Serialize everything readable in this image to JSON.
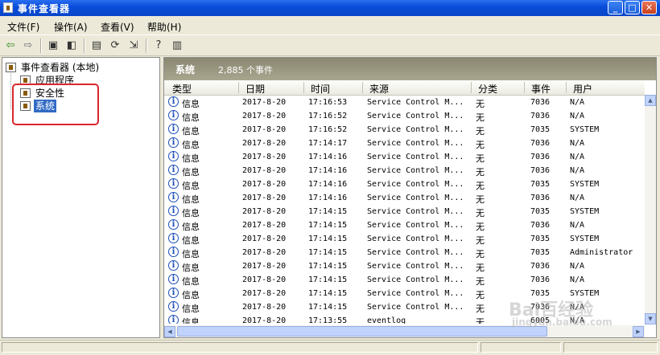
{
  "window": {
    "title": "事件查看器"
  },
  "menu": [
    "文件(F)",
    "操作(A)",
    "查看(V)",
    "帮助(H)"
  ],
  "tree": {
    "root": "事件查看器 (本地)",
    "items": [
      {
        "label": "应用程序",
        "selected": false
      },
      {
        "label": "安全性",
        "selected": false
      },
      {
        "label": "系统",
        "selected": true
      }
    ]
  },
  "list": {
    "name": "系统",
    "count": "2,885 个事件",
    "columns": [
      "类型",
      "日期",
      "时间",
      "来源",
      "分类",
      "事件",
      "用户"
    ],
    "rows": [
      {
        "type": "信息",
        "date": "2017-8-20",
        "time": "17:16:53",
        "source": "Service Control M...",
        "category": "无",
        "event": "7036",
        "user": "N/A"
      },
      {
        "type": "信息",
        "date": "2017-8-20",
        "time": "17:16:52",
        "source": "Service Control M...",
        "category": "无",
        "event": "7036",
        "user": "N/A"
      },
      {
        "type": "信息",
        "date": "2017-8-20",
        "time": "17:16:52",
        "source": "Service Control M...",
        "category": "无",
        "event": "7035",
        "user": "SYSTEM"
      },
      {
        "type": "信息",
        "date": "2017-8-20",
        "time": "17:14:17",
        "source": "Service Control M...",
        "category": "无",
        "event": "7036",
        "user": "N/A"
      },
      {
        "type": "信息",
        "date": "2017-8-20",
        "time": "17:14:16",
        "source": "Service Control M...",
        "category": "无",
        "event": "7036",
        "user": "N/A"
      },
      {
        "type": "信息",
        "date": "2017-8-20",
        "time": "17:14:16",
        "source": "Service Control M...",
        "category": "无",
        "event": "7036",
        "user": "N/A"
      },
      {
        "type": "信息",
        "date": "2017-8-20",
        "time": "17:14:16",
        "source": "Service Control M...",
        "category": "无",
        "event": "7035",
        "user": "SYSTEM"
      },
      {
        "type": "信息",
        "date": "2017-8-20",
        "time": "17:14:16",
        "source": "Service Control M...",
        "category": "无",
        "event": "7036",
        "user": "N/A"
      },
      {
        "type": "信息",
        "date": "2017-8-20",
        "time": "17:14:15",
        "source": "Service Control M...",
        "category": "无",
        "event": "7035",
        "user": "SYSTEM"
      },
      {
        "type": "信息",
        "date": "2017-8-20",
        "time": "17:14:15",
        "source": "Service Control M...",
        "category": "无",
        "event": "7036",
        "user": "N/A"
      },
      {
        "type": "信息",
        "date": "2017-8-20",
        "time": "17:14:15",
        "source": "Service Control M...",
        "category": "无",
        "event": "7035",
        "user": "SYSTEM"
      },
      {
        "type": "信息",
        "date": "2017-8-20",
        "time": "17:14:15",
        "source": "Service Control M...",
        "category": "无",
        "event": "7035",
        "user": "Administrator"
      },
      {
        "type": "信息",
        "date": "2017-8-20",
        "time": "17:14:15",
        "source": "Service Control M...",
        "category": "无",
        "event": "7036",
        "user": "N/A"
      },
      {
        "type": "信息",
        "date": "2017-8-20",
        "time": "17:14:15",
        "source": "Service Control M...",
        "category": "无",
        "event": "7036",
        "user": "N/A"
      },
      {
        "type": "信息",
        "date": "2017-8-20",
        "time": "17:14:15",
        "source": "Service Control M...",
        "category": "无",
        "event": "7035",
        "user": "SYSTEM"
      },
      {
        "type": "信息",
        "date": "2017-8-20",
        "time": "17:14:15",
        "source": "Service Control M...",
        "category": "无",
        "event": "7036",
        "user": "N/A"
      },
      {
        "type": "信息",
        "date": "2017-8-20",
        "time": "17:13:55",
        "source": "eventlog",
        "category": "无",
        "event": "6005",
        "user": "N/A"
      }
    ]
  },
  "watermark": {
    "brand": "Bai百经验",
    "url": "jingyan.baidu.com"
  }
}
